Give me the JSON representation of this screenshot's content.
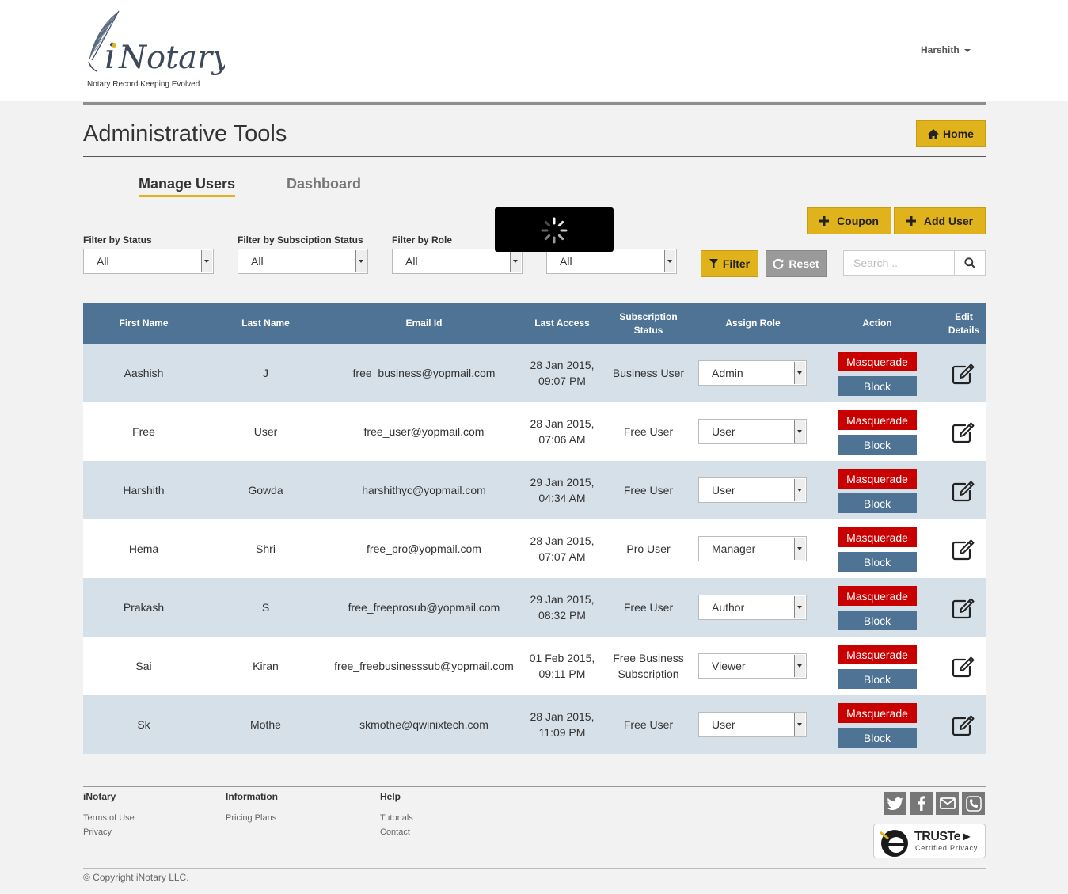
{
  "header": {
    "brand": "iNotary",
    "tagline": "Notary Record Keeping Evolved",
    "user_name": "Harshith"
  },
  "page": {
    "title": "Administrative Tools",
    "home_label": "Home"
  },
  "tabs": [
    {
      "label": "Manage Users",
      "active": true
    },
    {
      "label": "Dashboard",
      "active": false
    }
  ],
  "actions": {
    "coupon_label": "Coupon",
    "add_user_label": "Add User"
  },
  "filters": {
    "status": {
      "label": "Filter by Status",
      "value": "All"
    },
    "subscription": {
      "label": "Filter by Subsciption Status",
      "value": "All"
    },
    "role": {
      "label": "Filter by Role",
      "value": "All"
    },
    "fourth": {
      "value": "All"
    },
    "filter_label": "Filter",
    "reset_label": "Reset",
    "search_placeholder": "Search .."
  },
  "table": {
    "headers": {
      "first_name": "First Name",
      "last_name": "Last Name",
      "email": "Email Id",
      "last_access": "Last Access",
      "sub_status_1": "Subscription",
      "sub_status_2": "Status",
      "assign_role": "Assign Role",
      "action": "Action",
      "edit_1": "Edit",
      "edit_2": "Details"
    },
    "masquerade_label": "Masquerade",
    "block_label": "Block",
    "rows": [
      {
        "first": "Aashish",
        "last": "J",
        "email": "free_business@yopmail.com",
        "date": "28 Jan 2015,",
        "time": "09:07 PM",
        "sub1": "Business User",
        "sub2": "",
        "role": "Admin"
      },
      {
        "first": "Free",
        "last": "User",
        "email": "free_user@yopmail.com",
        "date": "28 Jan 2015,",
        "time": "07:06 AM",
        "sub1": "Free User",
        "sub2": "",
        "role": "User"
      },
      {
        "first": "Harshith",
        "last": "Gowda",
        "email": "harshithyc@yopmail.com",
        "date": "29 Jan 2015,",
        "time": "04:34 AM",
        "sub1": "Free User",
        "sub2": "",
        "role": "User"
      },
      {
        "first": "Hema",
        "last": "Shri",
        "email": "free_pro@yopmail.com",
        "date": "28 Jan 2015,",
        "time": "07:07 AM",
        "sub1": "Pro User",
        "sub2": "",
        "role": "Manager"
      },
      {
        "first": "Prakash",
        "last": "S",
        "email": "free_freeprosub@yopmail.com",
        "date": "29 Jan 2015,",
        "time": "08:32 PM",
        "sub1": "Free User",
        "sub2": "",
        "role": "Author"
      },
      {
        "first": "Sai",
        "last": "Kiran",
        "email": "free_freebusinesssub@yopmail.com",
        "date": "01 Feb 2015,",
        "time": "09:11 PM",
        "sub1": "Free Business",
        "sub2": "Subscription",
        "role": "Viewer"
      },
      {
        "first": "Sk",
        "last": "Mothe",
        "email": "skmothe@qwinixtech.com",
        "date": "28 Jan 2015,",
        "time": "11:09 PM",
        "sub1": "Free User",
        "sub2": "",
        "role": "User"
      }
    ]
  },
  "footer": {
    "col1": {
      "title": "iNotary",
      "links": [
        "Terms of Use",
        "Privacy"
      ]
    },
    "col2": {
      "title": "Information",
      "links": [
        "Pricing Plans"
      ]
    },
    "col3": {
      "title": "Help",
      "links": [
        "Tutorials",
        "Contact"
      ]
    },
    "social_icons": [
      "twitter-icon",
      "facebook-icon",
      "mail-icon",
      "phone-icon"
    ],
    "truste_title": "TRUSTe",
    "truste_sub": "Certified Privacy",
    "copyright": "© Copyright iNotary LLC."
  },
  "colors": {
    "accent": "#e0b21c",
    "table_header": "#4f7394",
    "row_alt": "#d6e0e8",
    "danger": "#c80000"
  }
}
